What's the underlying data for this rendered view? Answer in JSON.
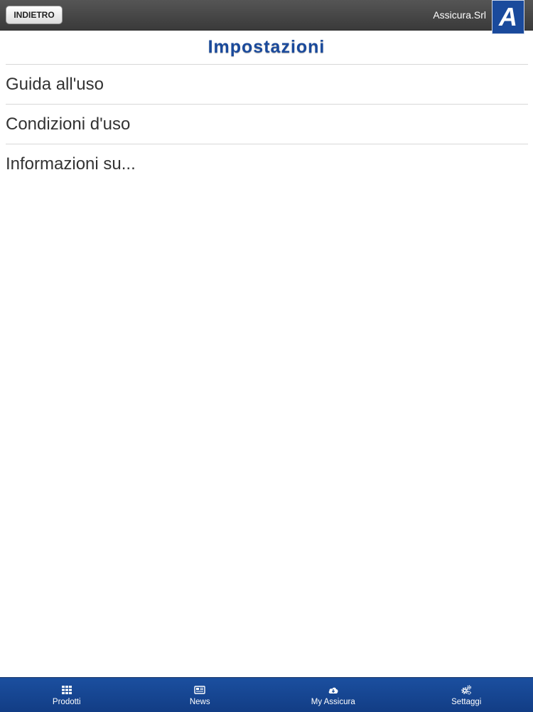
{
  "header": {
    "back_label": "INDIETRO",
    "brand": "Assicura.Srl",
    "logo_letter": "A",
    "accent": "#1a4a9c"
  },
  "page": {
    "title": "Impostazioni"
  },
  "menu": {
    "items": [
      {
        "label": "Guida all'uso"
      },
      {
        "label": "Condizioni d'uso"
      },
      {
        "label": "Informazioni su..."
      }
    ]
  },
  "tabbar": {
    "tabs": [
      {
        "label": "Prodotti",
        "icon": "grid-icon"
      },
      {
        "label": "News",
        "icon": "newspaper-icon"
      },
      {
        "label": "My Assicura",
        "icon": "cloud-download-icon"
      },
      {
        "label": "Settaggi",
        "icon": "gears-icon"
      }
    ]
  }
}
